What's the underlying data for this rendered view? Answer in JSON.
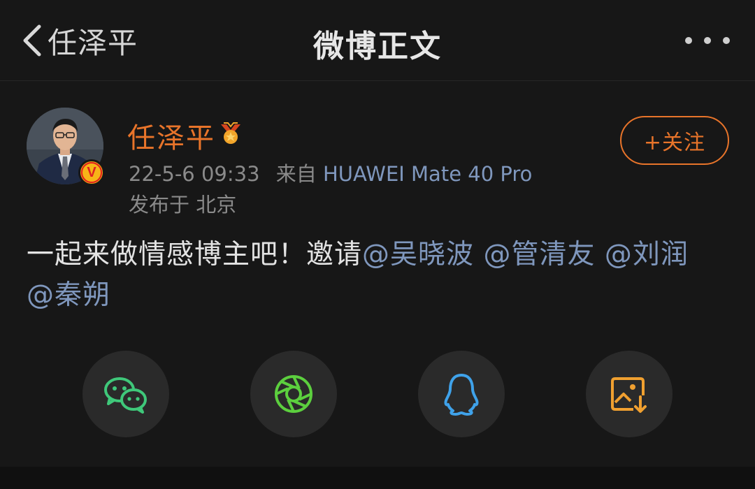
{
  "header": {
    "back_label": "任泽平",
    "title": "微博正文",
    "icons": {
      "back": "chevron-left-icon",
      "more": "more-dots-icon"
    }
  },
  "author": {
    "name": "任泽平",
    "verified_badge": "V",
    "timestamp": "22-5-6 09:33",
    "source_prefix": "来自",
    "device": "HUAWEI Mate 40 Pro",
    "location": "发布于 北京",
    "follow_label": "+关注"
  },
  "post": {
    "text": "一起来做情感博主吧！邀请",
    "mentions": [
      "@吴晓波",
      "@管清友",
      "@刘润",
      "@秦朔"
    ]
  },
  "share": [
    {
      "name": "wechat-icon",
      "color": "#3fc87a"
    },
    {
      "name": "moments-icon",
      "color": "#5ccf3e"
    },
    {
      "name": "qq-icon",
      "color": "#3fa2ea"
    },
    {
      "name": "save-image-icon",
      "color": "#f0a030"
    }
  ],
  "colors": {
    "accent": "#e8742a",
    "link": "#7f97bd",
    "background": "#171717"
  }
}
